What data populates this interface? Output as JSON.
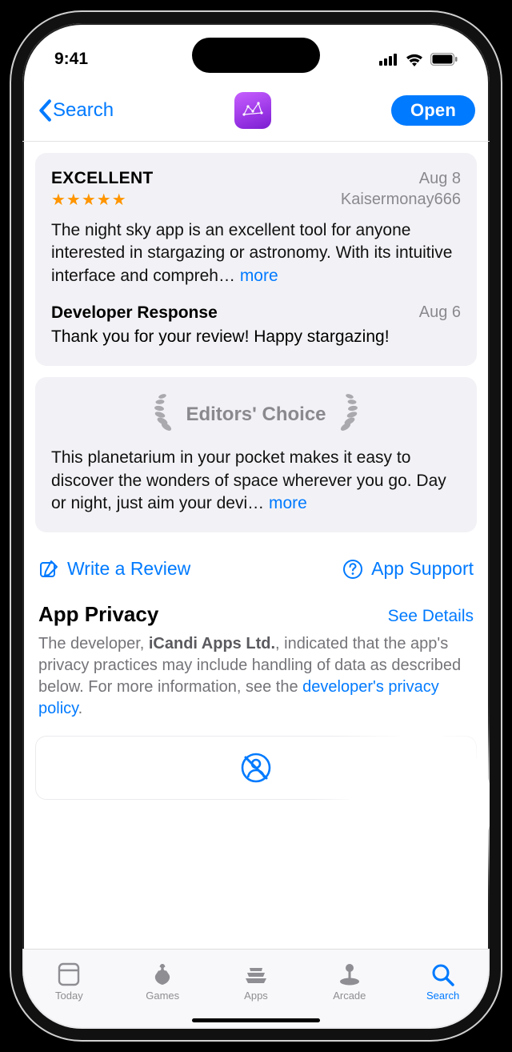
{
  "status_bar": {
    "time": "9:41"
  },
  "nav": {
    "back_label": "Search",
    "open_label": "Open"
  },
  "review": {
    "title": "EXCELLENT",
    "date": "Aug 8",
    "stars": "★★★★★",
    "author": "Kaisermonay666",
    "body": "The night sky app is an excellent tool for anyone interested in stargazing or astronomy. With its intuitive interface and compreh",
    "more": "more",
    "dev_label": "Developer Response",
    "dev_date": "Aug 6",
    "dev_body": "Thank you for your review! Happy stargazing!"
  },
  "editors": {
    "label": "Editors' Choice",
    "body": "This planetarium in your pocket makes it easy to discover the wonders of space wherever you go. Day or night, just aim your devi",
    "more": "more"
  },
  "actions": {
    "write_review": "Write a Review",
    "app_support": "App Support"
  },
  "privacy": {
    "title": "App Privacy",
    "see_details": "See Details",
    "pre": "The developer, ",
    "developer": "iCandi Apps Ltd.",
    "mid": ", indicated that the app's privacy practices may include handling of data as described below. For more information, see the ",
    "link": "developer's privacy policy",
    "post": "."
  },
  "tabs": {
    "today": "Today",
    "games": "Games",
    "apps": "Apps",
    "arcade": "Arcade",
    "search": "Search"
  }
}
